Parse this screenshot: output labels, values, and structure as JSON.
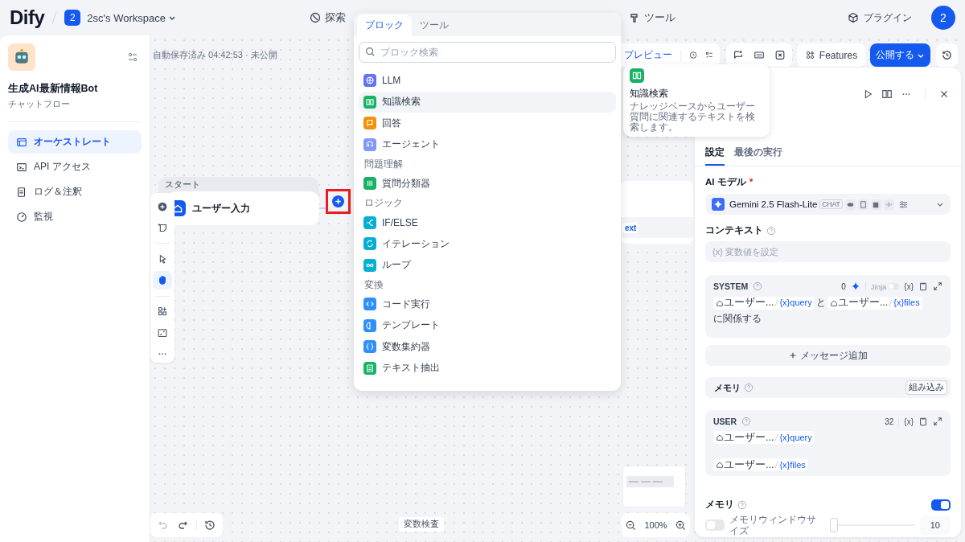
{
  "header": {
    "logo": "Dify",
    "workspace_badge": "2",
    "workspace": "2sc's Workspace",
    "nav": [
      {
        "label": "探索"
      },
      {
        "label": "ツール"
      }
    ],
    "plugins": "プラグイン",
    "avatar": "2"
  },
  "sidebar": {
    "app_name": "生成AI最新情報Bot",
    "app_type": "チャットフロー",
    "items": [
      {
        "label": "オーケストレート",
        "selected": true
      },
      {
        "label": "API アクセス",
        "selected": false
      },
      {
        "label": "ログ＆注釈",
        "selected": false
      },
      {
        "label": "監視",
        "selected": false
      }
    ]
  },
  "canvas": {
    "autosave": "自動保存済み 04:42:53 · 未公開",
    "start_node": {
      "group": "スタート",
      "title": "ユーザー入力"
    },
    "hidden_node_tag": "ext",
    "tools": [
      {
        "selected": false
      },
      {
        "selected": true
      }
    ],
    "variable_inspect": "変数検査",
    "zoom": "100%"
  },
  "toolbar": {
    "preview": "プレビュー",
    "features": "Features",
    "publish": "公開する"
  },
  "block_picker": {
    "tabs": [
      {
        "label": "ブロック",
        "selected": true
      },
      {
        "label": "ツール",
        "selected": false
      }
    ],
    "search_placeholder": "ブロック検索",
    "items": [
      {
        "kind": "block",
        "label": "LLM",
        "color": "#6172f3",
        "selected": false
      },
      {
        "kind": "block",
        "label": "知識検索",
        "color": "#16b364",
        "selected": true
      },
      {
        "kind": "block",
        "label": "回答",
        "color": "#f79009",
        "selected": false
      },
      {
        "kind": "block",
        "label": "エージェント",
        "color": "#8098f9",
        "selected": false
      },
      {
        "kind": "section",
        "label": "問題理解"
      },
      {
        "kind": "block",
        "label": "質問分類器",
        "color": "#16b364",
        "selected": false
      },
      {
        "kind": "section",
        "label": "ロジック"
      },
      {
        "kind": "block",
        "label": "IF/ELSE",
        "color": "#06aed4",
        "selected": false
      },
      {
        "kind": "block",
        "label": "イテレーション",
        "color": "#06aed4",
        "selected": false
      },
      {
        "kind": "block",
        "label": "ループ",
        "color": "#06aed4",
        "selected": false
      },
      {
        "kind": "section",
        "label": "変換"
      },
      {
        "kind": "block",
        "label": "コード実行",
        "color": "#2e90fa",
        "selected": false
      },
      {
        "kind": "block",
        "label": "テンプレート",
        "color": "#2e90fa",
        "selected": false
      },
      {
        "kind": "block",
        "label": "変数集約器",
        "color": "#2e90fa",
        "selected": false
      },
      {
        "kind": "block",
        "label": "テキスト抽出",
        "color": "#16b364",
        "selected": false
      }
    ]
  },
  "tooltip": {
    "title": "知識検索",
    "description": "ナレッジベースからユーザー質問に関連するテキストを検索します。"
  },
  "panel": {
    "tabs": [
      {
        "label": "設定",
        "selected": true
      },
      {
        "label": "最後の実行",
        "selected": false
      }
    ],
    "model_label": "AI モデル",
    "model_required": true,
    "model": "Gemini 2.5 Flash-Lite",
    "model_mode": "CHAT",
    "context_label": "コンテキスト",
    "context_placeholder": "{x} 変数値を設定",
    "system": {
      "role": "SYSTEM",
      "count": "0",
      "jinja": "Jinja",
      "jinja_on": false,
      "var_button": "{x}",
      "content": [
        {
          "kind": "var",
          "node": "ユーザー...",
          "var": "{x}query"
        },
        {
          "kind": "text",
          "text": "と"
        },
        {
          "kind": "var",
          "node": "ユーザー...",
          "var": "{x}files"
        },
        {
          "kind": "text",
          "text": "に関係する"
        }
      ]
    },
    "add_message": "メッセージ追加",
    "memory_builtin": {
      "label": "メモリ",
      "badge": "組み込み"
    },
    "user": {
      "role": "USER",
      "count": "32",
      "var_button": "{x}",
      "content": [
        {
          "kind": "var",
          "node": "ユーザー...",
          "var": "{x}query"
        },
        {
          "kind": "var",
          "node": "ユーザー...",
          "var": "{x}files"
        }
      ]
    },
    "memory": {
      "label": "メモリ",
      "on": true
    },
    "window_size": {
      "label": "メモリウィンドウサイズ",
      "on": false,
      "level": 0.05,
      "value": "10"
    }
  }
}
